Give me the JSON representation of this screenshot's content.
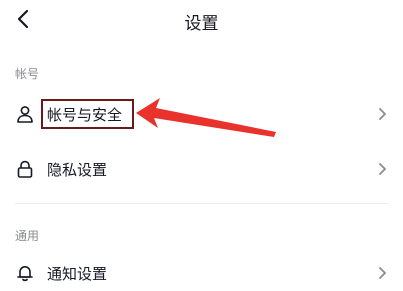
{
  "header": {
    "back_icon": "chevron-left-icon",
    "title": "设置"
  },
  "sections": [
    {
      "label": "帐号",
      "items": [
        {
          "label": "帐号与安全",
          "icon": "user-icon",
          "highlighted": true
        },
        {
          "label": "隐私设置",
          "icon": "lock-icon",
          "highlighted": false
        }
      ]
    },
    {
      "label": "通用",
      "items": [
        {
          "label": "通知设置",
          "icon": "bell-icon",
          "highlighted": false
        }
      ]
    }
  ],
  "annotation": {
    "box_color": "#6b1a1a",
    "arrow_color": "#e8322b"
  }
}
